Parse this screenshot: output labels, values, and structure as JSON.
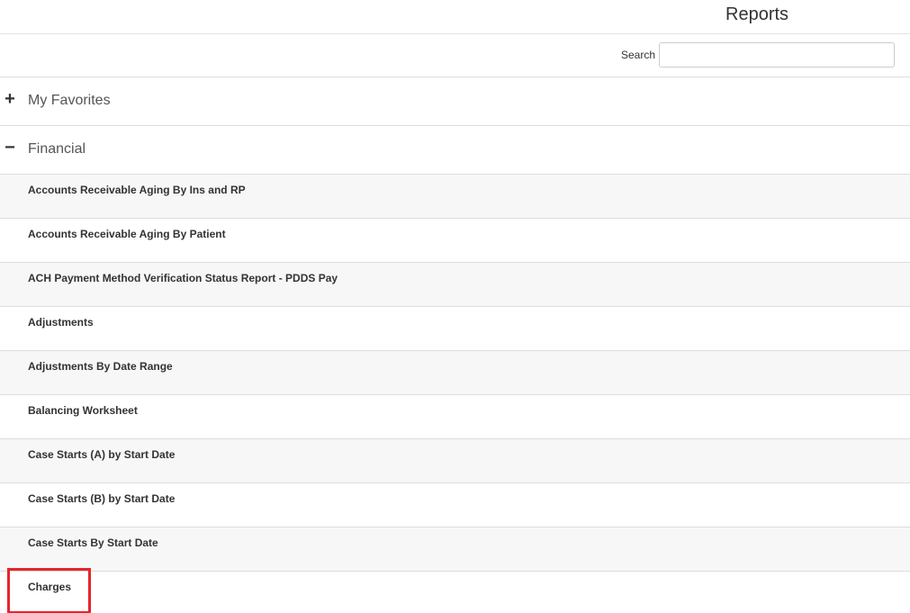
{
  "header": {
    "title": "Reports"
  },
  "search": {
    "label": "Search",
    "value": "",
    "placeholder": ""
  },
  "sections": {
    "favorites": {
      "toggle": "+",
      "label": "My Favorites"
    },
    "financial": {
      "toggle": "−",
      "label": "Financial"
    }
  },
  "reports": [
    "Accounts Receivable Aging By Ins and RP",
    "Accounts Receivable Aging By Patient",
    "ACH Payment Method Verification Status Report - PDDS Pay",
    "Adjustments",
    "Adjustments By Date Range",
    "Balancing Worksheet",
    "Case Starts (A) by Start Date",
    "Case Starts (B) by Start Date",
    "Case Starts By Start Date",
    "Charges"
  ],
  "highlight": {
    "target": "Charges",
    "color": "#e3262b"
  }
}
